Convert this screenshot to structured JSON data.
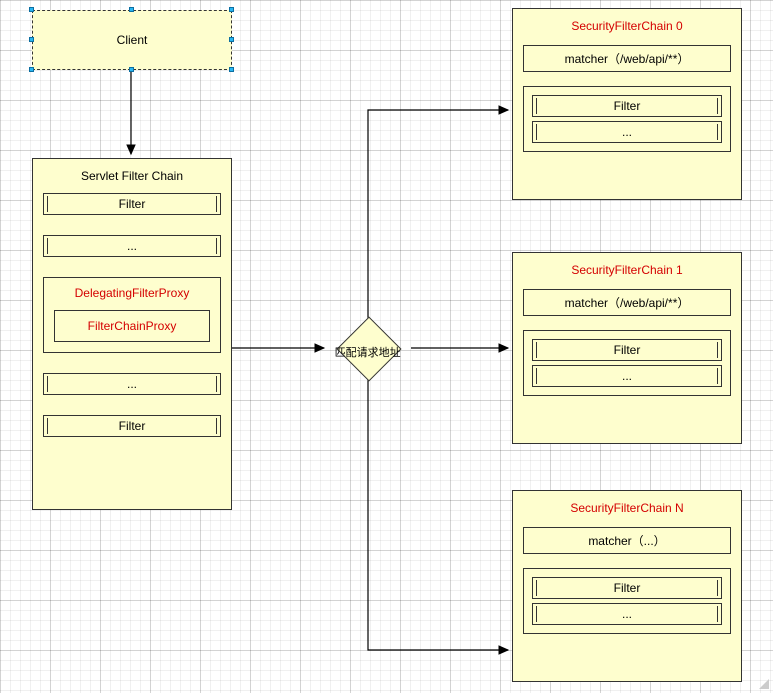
{
  "client": {
    "label": "Client"
  },
  "servlet_chain": {
    "title": "Servlet Filter Chain",
    "filter1": "Filter",
    "dots1": "...",
    "delegating_title": "DelegatingFilterProxy",
    "filter_chain_proxy": "FilterChainProxy",
    "dots2": "...",
    "filter2": "Filter"
  },
  "decision": {
    "label": "匹配请求地址"
  },
  "chain0": {
    "title": "SecurityFilterChain 0",
    "matcher": "matcher（/web/api/**）",
    "filter": "Filter",
    "dots": "..."
  },
  "chain1": {
    "title": "SecurityFilterChain 1",
    "matcher": "matcher（/web/api/**）",
    "filter": "Filter",
    "dots": "..."
  },
  "chainN": {
    "title": "SecurityFilterChain N",
    "matcher": "matcher（...）",
    "filter": "Filter",
    "dots": "..."
  },
  "chart_data": {
    "type": "flow",
    "nodes": [
      {
        "id": "client",
        "label": "Client"
      },
      {
        "id": "servlet_chain",
        "label": "Servlet Filter Chain",
        "children": [
          "Filter",
          "...",
          {
            "id": "delegating",
            "label": "DelegatingFilterProxy",
            "children": [
              "FilterChainProxy"
            ]
          },
          "...",
          "Filter"
        ]
      },
      {
        "id": "decision",
        "label": "匹配请求地址"
      },
      {
        "id": "sfc0",
        "label": "SecurityFilterChain 0",
        "children": [
          "matcher（/web/api/**）",
          "Filter",
          "..."
        ]
      },
      {
        "id": "sfc1",
        "label": "SecurityFilterChain 1",
        "children": [
          "matcher（/web/api/**）",
          "Filter",
          "..."
        ]
      },
      {
        "id": "sfcN",
        "label": "SecurityFilterChain N",
        "children": [
          "matcher（...）",
          "Filter",
          "..."
        ]
      }
    ],
    "edges": [
      {
        "from": "client",
        "to": "servlet_chain"
      },
      {
        "from": "servlet_chain.delegating.FilterChainProxy",
        "to": "decision"
      },
      {
        "from": "decision",
        "to": "sfc0"
      },
      {
        "from": "decision",
        "to": "sfc1"
      },
      {
        "from": "decision",
        "to": "sfcN"
      }
    ]
  }
}
